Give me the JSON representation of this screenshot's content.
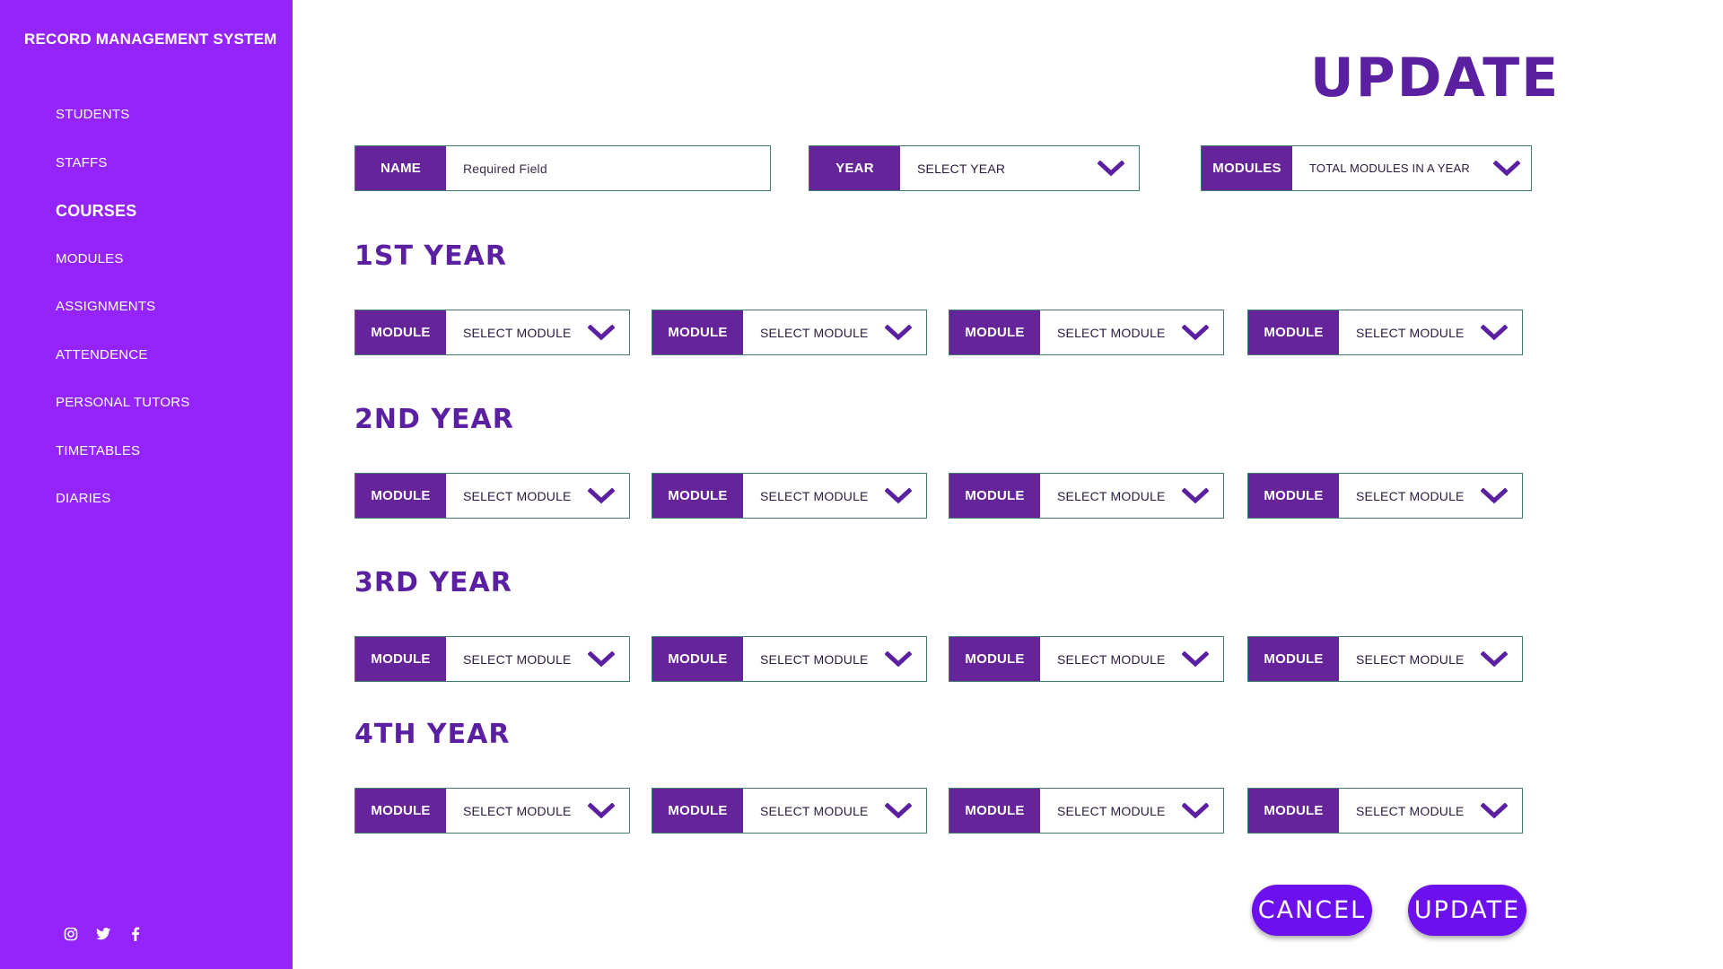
{
  "sidebar": {
    "brand": "RECORD MANAGEMENT SYSTEM",
    "items": [
      {
        "label": "STUDENTS"
      },
      {
        "label": "STAFFS"
      },
      {
        "label": "COURSES"
      },
      {
        "label": "MODULES"
      },
      {
        "label": "ASSIGNMENTS"
      },
      {
        "label": "ATTENDENCE"
      },
      {
        "label": "PERSONAL TUTORS"
      },
      {
        "label": "TIMETABLES"
      },
      {
        "label": "DIARIES"
      }
    ],
    "active_item": "COURSES",
    "social_icons": [
      "instagram-icon",
      "twitter-icon",
      "facebook-icon"
    ]
  },
  "header": {
    "title": "UPDATE"
  },
  "form": {
    "name": {
      "label": "NAME",
      "placeholder": "Required Field"
    },
    "year": {
      "label": "YEAR",
      "value": "SELECT YEAR"
    },
    "modules": {
      "label": "MODULES",
      "value": "TOTAL MODULES IN A YEAR"
    }
  },
  "years": [
    {
      "title": "1ST YEAR",
      "modules": [
        {
          "label": "MODULE",
          "value": "SELECT MODULE"
        },
        {
          "label": "MODULE",
          "value": "SELECT MODULE"
        },
        {
          "label": "MODULE",
          "value": "SELECT MODULE"
        },
        {
          "label": "MODULE",
          "value": "SELECT MODULE"
        }
      ]
    },
    {
      "title": "2ND YEAR",
      "modules": [
        {
          "label": "MODULE",
          "value": "SELECT MODULE"
        },
        {
          "label": "MODULE",
          "value": "SELECT MODULE"
        },
        {
          "label": "MODULE",
          "value": "SELECT MODULE"
        },
        {
          "label": "MODULE",
          "value": "SELECT MODULE"
        }
      ]
    },
    {
      "title": "3RD YEAR",
      "modules": [
        {
          "label": "MODULE",
          "value": "SELECT MODULE"
        },
        {
          "label": "MODULE",
          "value": "SELECT MODULE"
        },
        {
          "label": "MODULE",
          "value": "SELECT MODULE"
        },
        {
          "label": "MODULE",
          "value": "SELECT MODULE"
        }
      ]
    },
    {
      "title": "4TH YEAR",
      "modules": [
        {
          "label": "MODULE",
          "value": "SELECT MODULE"
        },
        {
          "label": "MODULE",
          "value": "SELECT MODULE"
        },
        {
          "label": "MODULE",
          "value": "SELECT MODULE"
        },
        {
          "label": "MODULE",
          "value": "SELECT MODULE"
        }
      ]
    }
  ],
  "actions": {
    "cancel_label": "CANCEL",
    "update_label": "UPDATE"
  },
  "colors": {
    "sidebar": "#9424fb",
    "label_bg": "#66249b",
    "title": "#5b20a2",
    "button": "#6d10f0",
    "field_border": "#3f7d6a"
  }
}
